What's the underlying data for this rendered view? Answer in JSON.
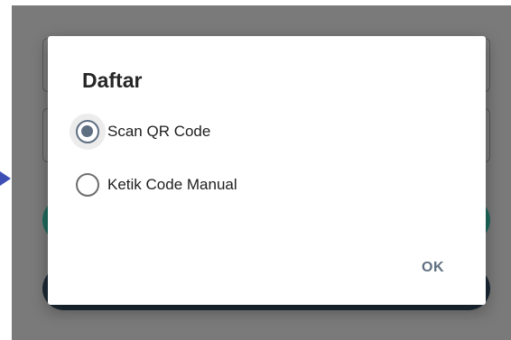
{
  "dialog": {
    "title": "Daftar",
    "options": [
      {
        "label": "Scan QR Code",
        "checked": true
      },
      {
        "label": "Ketik Code Manual",
        "checked": false
      }
    ],
    "ok_label": "OK"
  },
  "colors": {
    "accent": "#5f6f82",
    "scrim": "#7a7a7a",
    "pointer_arrow": "#3d4fb5",
    "bg_button_green": "#1f6b5e",
    "bg_button_dark": "#1c2a36"
  }
}
